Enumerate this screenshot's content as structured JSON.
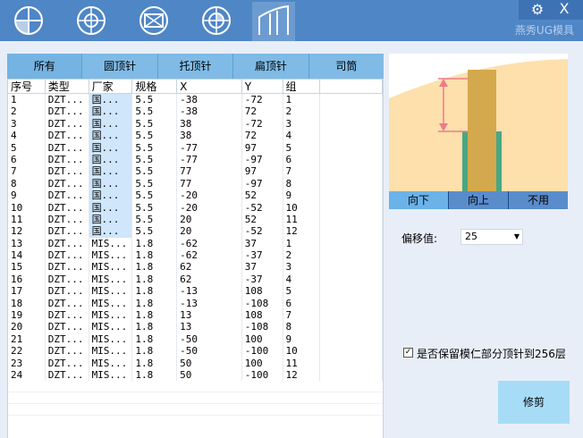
{
  "header": {
    "brand": "燕秀UG模具",
    "toolbar_icons": [
      "all-ejector-icon",
      "round-ejector-icon",
      "blade-ejector-icon",
      "flat-ejector-icon",
      "sleeve-ejector-icon"
    ],
    "gear_glyph": "⚙",
    "close_glyph": "X"
  },
  "tabs": [
    {
      "label": "所有"
    },
    {
      "label": "圆顶针"
    },
    {
      "label": "托顶针"
    },
    {
      "label": "扁顶针"
    },
    {
      "label": "司筒"
    }
  ],
  "table": {
    "columns": [
      "序号",
      "类型",
      "厂家",
      "规格",
      "X",
      "Y",
      "组"
    ],
    "rows": [
      [
        "1",
        "DZT...",
        "国...",
        "5.5",
        "-38",
        "-72",
        "1"
      ],
      [
        "2",
        "DZT...",
        "国...",
        "5.5",
        "-38",
        "72",
        "2"
      ],
      [
        "3",
        "DZT...",
        "国...",
        "5.5",
        "38",
        "-72",
        "3"
      ],
      [
        "4",
        "DZT...",
        "国...",
        "5.5",
        "38",
        "72",
        "4"
      ],
      [
        "5",
        "DZT...",
        "国...",
        "5.5",
        "-77",
        "97",
        "5"
      ],
      [
        "6",
        "DZT...",
        "国...",
        "5.5",
        "-77",
        "-97",
        "6"
      ],
      [
        "7",
        "DZT...",
        "国...",
        "5.5",
        "77",
        "97",
        "7"
      ],
      [
        "8",
        "DZT...",
        "国...",
        "5.5",
        "77",
        "-97",
        "8"
      ],
      [
        "9",
        "DZT...",
        "国...",
        "5.5",
        "-20",
        "52",
        "9"
      ],
      [
        "10",
        "DZT...",
        "国...",
        "5.5",
        "-20",
        "-52",
        "10"
      ],
      [
        "11",
        "DZT...",
        "国...",
        "5.5",
        "20",
        "52",
        "11"
      ],
      [
        "12",
        "DZT...",
        "国...",
        "5.5",
        "20",
        "-52",
        "12"
      ],
      [
        "13",
        "DZT...",
        "MIS...",
        "1.8",
        "-62",
        "37",
        "1"
      ],
      [
        "14",
        "DZT...",
        "MIS...",
        "1.8",
        "-62",
        "-37",
        "2"
      ],
      [
        "15",
        "DZT...",
        "MIS...",
        "1.8",
        "62",
        "37",
        "3"
      ],
      [
        "16",
        "DZT...",
        "MIS...",
        "1.8",
        "62",
        "-37",
        "4"
      ],
      [
        "17",
        "DZT...",
        "MIS...",
        "1.8",
        "-13",
        "108",
        "5"
      ],
      [
        "18",
        "DZT...",
        "MIS...",
        "1.8",
        "-13",
        "-108",
        "6"
      ],
      [
        "19",
        "DZT...",
        "MIS...",
        "1.8",
        "13",
        "108",
        "7"
      ],
      [
        "20",
        "DZT...",
        "MIS...",
        "1.8",
        "13",
        "-108",
        "8"
      ],
      [
        "21",
        "DZT...",
        "MIS...",
        "1.8",
        "-50",
        "100",
        "9"
      ],
      [
        "22",
        "DZT...",
        "MIS...",
        "1.8",
        "-50",
        "-100",
        "10"
      ],
      [
        "23",
        "DZT...",
        "MIS...",
        "1.8",
        "50",
        "100",
        "11"
      ],
      [
        "24",
        "DZT...",
        "MIS...",
        "1.8",
        "50",
        "-100",
        "12"
      ]
    ]
  },
  "direction": {
    "options": [
      {
        "label": "向下"
      },
      {
        "label": "向上"
      },
      {
        "label": "不用"
      }
    ]
  },
  "offset": {
    "label": "偏移值:",
    "value": "25"
  },
  "keep_option": {
    "label": "是否保留模仁部分顶针到256层",
    "checked": true
  },
  "trim_button": {
    "label": "修剪"
  },
  "colors": {
    "toolbar": "#4f86c6",
    "tab": "#7fbbe6",
    "diagram_fill": "#fde0ac",
    "pin": "#d4a84c",
    "sleeve": "#4aa683",
    "dimension": "#f07a8a"
  }
}
